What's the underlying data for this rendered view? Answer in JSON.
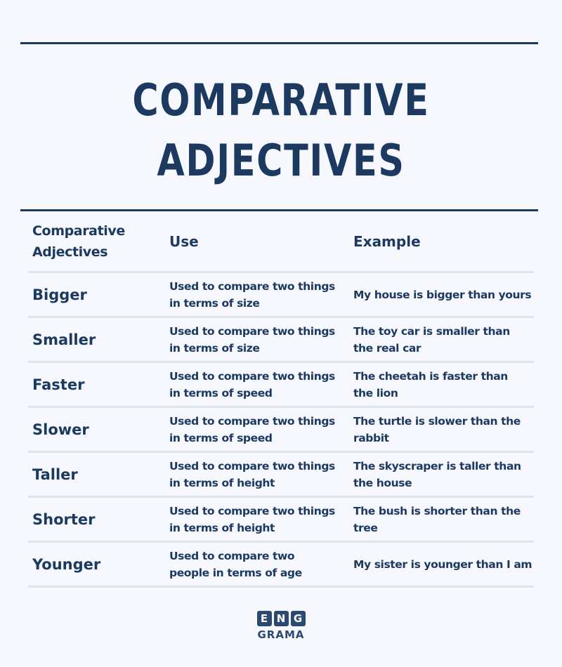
{
  "title": {
    "line1": "COMPARATIVE",
    "line2": "ADJECTIVES"
  },
  "table": {
    "headers": {
      "col1_line1": "Comparative",
      "col1_line2": "Adjectives",
      "col2": "Use",
      "col3": "Example"
    },
    "rows": [
      {
        "adjective": "Bigger",
        "use_1": "Used to compare two things",
        "use_2": "in terms of size",
        "example_1": "My house is bigger than yours",
        "example_2": ""
      },
      {
        "adjective": "Smaller",
        "use_1": "Used to compare two things",
        "use_2": "in terms of size",
        "example_1": "The toy car is smaller than",
        "example_2": "the real car"
      },
      {
        "adjective": "Faster",
        "use_1": "Used to compare two things",
        "use_2": "in terms of speed",
        "example_1": "The cheetah is faster than",
        "example_2": "the lion"
      },
      {
        "adjective": "Slower",
        "use_1": "Used to compare two things",
        "use_2": "in terms of speed",
        "example_1": "The turtle is slower than the",
        "example_2": "rabbit"
      },
      {
        "adjective": "Taller",
        "use_1": "Used to compare two things",
        "use_2": "in terms of height",
        "example_1": "The skyscraper is taller than",
        "example_2": "the house"
      },
      {
        "adjective": "Shorter",
        "use_1": "Used to compare two things",
        "use_2": "in terms of height",
        "example_1": "The bush is shorter than the",
        "example_2": "tree"
      },
      {
        "adjective": "Younger",
        "use_1": "Used to compare two",
        "use_2": "people in terms of age",
        "example_1": "My sister is younger than I am",
        "example_2": ""
      }
    ]
  },
  "logo": {
    "tiles": [
      "E",
      "N",
      "G"
    ],
    "text": "GRAMA"
  },
  "colors": {
    "text": "#1c3a60",
    "background": "#f6f8fe",
    "divider": "#dde4f0",
    "logo": "#2b4a72"
  }
}
